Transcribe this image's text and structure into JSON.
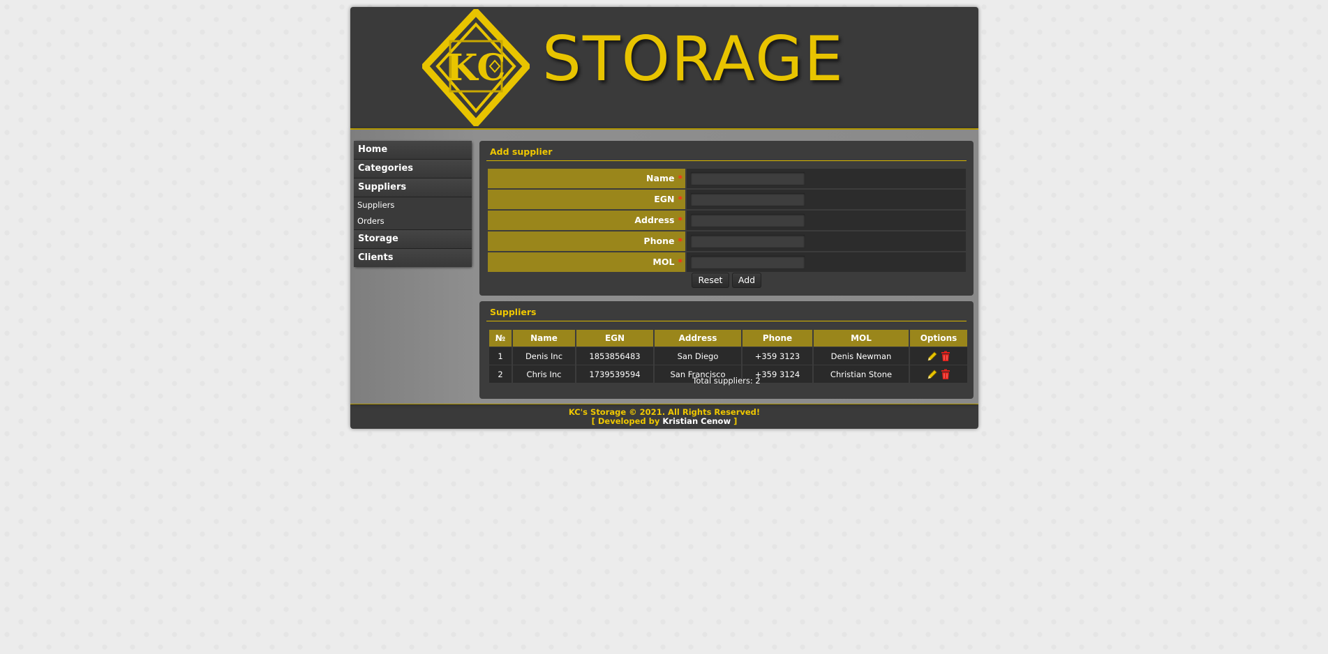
{
  "header": {
    "logo_text": "STORAGE",
    "logo_mark_text": "KC"
  },
  "sidebar": {
    "items": [
      {
        "label": "Home"
      },
      {
        "label": "Categories"
      },
      {
        "label": "Suppliers",
        "subitems": [
          {
            "label": "Suppliers"
          },
          {
            "label": "Orders"
          }
        ]
      },
      {
        "label": "Storage"
      },
      {
        "label": "Clients"
      }
    ]
  },
  "add_form": {
    "title": "Add supplier",
    "fields": [
      {
        "label": "Name",
        "value": ""
      },
      {
        "label": "EGN",
        "value": ""
      },
      {
        "label": "Address",
        "value": ""
      },
      {
        "label": "Phone",
        "value": ""
      },
      {
        "label": "MOL",
        "value": ""
      }
    ],
    "required_mark": "*",
    "reset_label": "Reset",
    "add_label": "Add"
  },
  "suppliers": {
    "title": "Suppliers",
    "columns": [
      "№",
      "Name",
      "EGN",
      "Address",
      "Phone",
      "MOL",
      "Options"
    ],
    "rows": [
      {
        "num": "1",
        "name": "Denis Inc",
        "egn": "1853856483",
        "address": "San Diego",
        "phone": "+359 3123",
        "mol": "Denis Newman"
      },
      {
        "num": "2",
        "name": "Chris Inc",
        "egn": "1739539594",
        "address": "San Francisco",
        "phone": "+359 3124",
        "mol": "Christian Stone"
      }
    ],
    "total_text": "Total suppliers: 2"
  },
  "footer": {
    "copyright": "KC's Storage © 2021. All Rights Reserved!",
    "dev_prefix": "[ Developed by",
    "dev_name": "Kristian Cenow",
    "dev_suffix": "]"
  },
  "colors": {
    "accent": "#e8c400",
    "label_bg": "#9a861b",
    "panel_bg": "#3c3c3c",
    "delete_red": "#e0201a"
  }
}
